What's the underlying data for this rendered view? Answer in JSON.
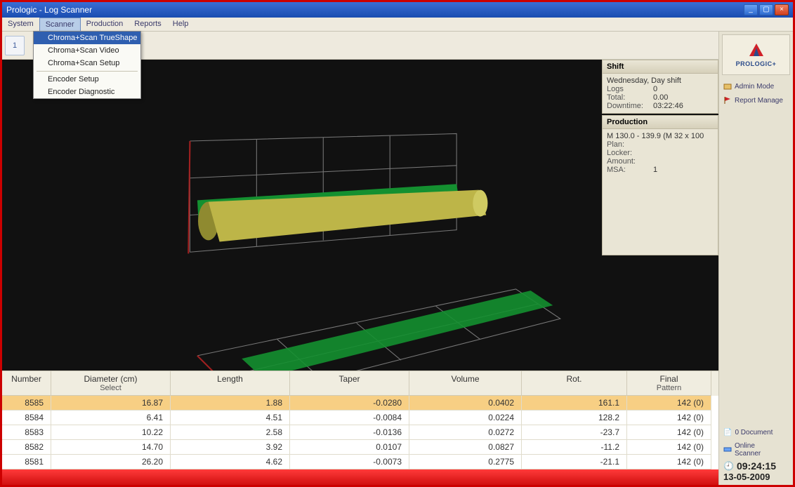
{
  "window": {
    "title": "Prologic - Log Scanner"
  },
  "menu": {
    "items": [
      "System",
      "Scanner",
      "Production",
      "Reports",
      "Help"
    ],
    "open_index": 1,
    "dropdown": {
      "items": [
        "Chroma+Scan TrueShape",
        "Chroma+Scan Video",
        "Chroma+Scan Setup",
        "---",
        "Encoder Setup",
        "Encoder Diagnostic"
      ],
      "selected_index": 0
    }
  },
  "toolbar": {
    "btn1": "1"
  },
  "shift": {
    "title": "Shift",
    "dayline": "Wednesday, Day shift",
    "rows": [
      {
        "label": "Logs",
        "value": "0"
      },
      {
        "label": "Total:",
        "value": "0.00"
      },
      {
        "label": "Downtime:",
        "value": "03:22:46"
      }
    ]
  },
  "production": {
    "title": "Production",
    "headline": "M 130.0 - 139.9 (M 32 x 100",
    "rows": [
      {
        "label": "Plan:",
        "value": ""
      },
      {
        "label": "Locker:",
        "value": ""
      },
      {
        "label": "Amount:",
        "value": ""
      },
      {
        "label": "MSA:",
        "value": "1"
      }
    ]
  },
  "rail": {
    "brand": "PROLOGIC+",
    "admin": "Admin Mode",
    "report": "Report Manage",
    "docs": "0 Document",
    "online": "Online",
    "scanner": "Scanner",
    "time": "09:24:15",
    "date": "13-05-2009"
  },
  "grid": {
    "headers": [
      {
        "top": "Number",
        "sub": ""
      },
      {
        "top": "Diameter (cm)",
        "sub": "Select"
      },
      {
        "top": "Length",
        "sub": ""
      },
      {
        "top": "Taper",
        "sub": ""
      },
      {
        "top": "Volume",
        "sub": ""
      },
      {
        "top": "Rot.",
        "sub": ""
      },
      {
        "top": "Final",
        "sub": "Pattern"
      }
    ],
    "rows": [
      {
        "cells": [
          "8585",
          "16.87",
          "1.88",
          "-0.0280",
          "0.0402",
          "161.1",
          "142 (0)"
        ],
        "selected": true
      },
      {
        "cells": [
          "8584",
          "6.41",
          "4.51",
          "-0.0084",
          "0.0224",
          "128.2",
          "142 (0)"
        ],
        "selected": false
      },
      {
        "cells": [
          "8583",
          "10.22",
          "2.58",
          "-0.0136",
          "0.0272",
          "-23.7",
          "142 (0)"
        ],
        "selected": false
      },
      {
        "cells": [
          "8582",
          "14.70",
          "3.92",
          "0.0107",
          "0.0827",
          "-11.2",
          "142 (0)"
        ],
        "selected": false
      },
      {
        "cells": [
          "8581",
          "26.20",
          "4.62",
          "-0.0073",
          "0.2775",
          "-21.1",
          "142 (0)"
        ],
        "selected": false
      }
    ]
  }
}
